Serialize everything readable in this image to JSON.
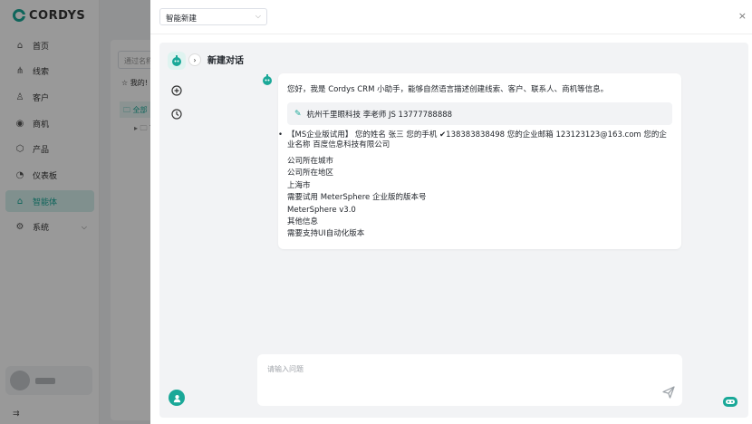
{
  "app": {
    "brand": "CORDYS",
    "nav": [
      {
        "label": "首页",
        "icon": "home-icon",
        "glyph": "⌂"
      },
      {
        "label": "线索",
        "icon": "leads-icon",
        "glyph": "⋔"
      },
      {
        "label": "客户",
        "icon": "customers-icon",
        "glyph": "♙"
      },
      {
        "label": "商机",
        "icon": "opportunity-icon",
        "glyph": "◉"
      },
      {
        "label": "产品",
        "icon": "product-icon",
        "glyph": "⬡"
      },
      {
        "label": "仪表板",
        "icon": "dashboard-icon",
        "glyph": "◔"
      },
      {
        "label": "智能体",
        "icon": "agent-icon",
        "glyph": "⌂",
        "active": true
      },
      {
        "label": "系统",
        "icon": "system-icon",
        "glyph": "⚙"
      }
    ],
    "background_panel": {
      "search_placeholder": "通过名称",
      "my_label": "☆ 我的!",
      "all_label": "🗀 全部",
      "sub_label": "▸ 🗀 T"
    }
  },
  "drawer": {
    "agent_select": "智能新建",
    "chat_title": "新建对话",
    "message": {
      "intro": "您好，我是 Cordys CRM 小助手，能够自然语言描述创建线索、客户、联系人、商机等信息。",
      "suggestion": "杭州千里眼科技 李老师 JS 13777788888",
      "bullet": "【MS企业版试用】 您的姓名 张三 您的手机 ✔138383838498 您的企业邮箱 123123123@163.com 您的企业名称 百度信息科技有限公司",
      "lines": [
        "公司所在城市",
        "公司所在地区",
        "上海市",
        "需要试用 MeterSphere 企业版的版本号",
        "MeterSphere v3.0",
        "其他信息",
        "需要支持UI自动化版本"
      ]
    },
    "input_placeholder": "请输入问题",
    "colors": {
      "accent": "#1aa898",
      "chat_bg": "#f2f3f5"
    }
  }
}
